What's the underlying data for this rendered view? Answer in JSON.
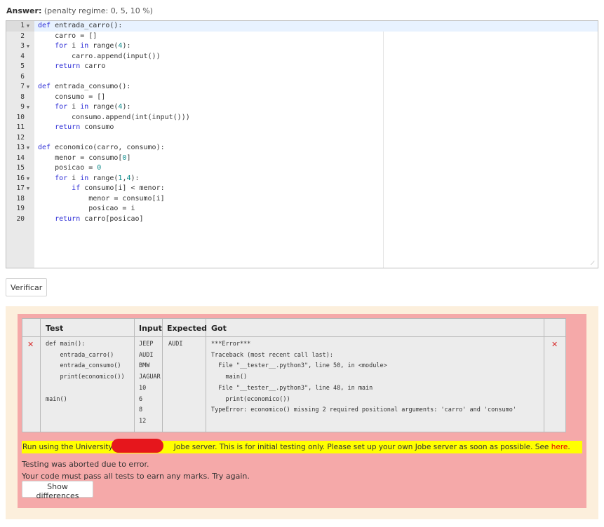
{
  "answer": {
    "label": "Answer:",
    "regime": "(penalty regime: 0, 5, 10 %)"
  },
  "editor": {
    "lines": [
      {
        "num": "1",
        "fold": true,
        "text": "def entrada_carro():"
      },
      {
        "num": "2",
        "fold": false,
        "text": "    carro = []"
      },
      {
        "num": "3",
        "fold": true,
        "text": "    for i in range(4):"
      },
      {
        "num": "4",
        "fold": false,
        "text": "        carro.append(input())"
      },
      {
        "num": "5",
        "fold": false,
        "text": "    return carro"
      },
      {
        "num": "6",
        "fold": false,
        "text": ""
      },
      {
        "num": "7",
        "fold": true,
        "text": "def entrada_consumo():"
      },
      {
        "num": "8",
        "fold": false,
        "text": "    consumo = []"
      },
      {
        "num": "9",
        "fold": true,
        "text": "    for i in range(4):"
      },
      {
        "num": "10",
        "fold": false,
        "text": "        consumo.append(int(input()))"
      },
      {
        "num": "11",
        "fold": false,
        "text": "    return consumo"
      },
      {
        "num": "12",
        "fold": false,
        "text": ""
      },
      {
        "num": "13",
        "fold": true,
        "text": "def economico(carro, consumo):"
      },
      {
        "num": "14",
        "fold": false,
        "text": "    menor = consumo[0]"
      },
      {
        "num": "15",
        "fold": false,
        "text": "    posicao = 0"
      },
      {
        "num": "16",
        "fold": true,
        "text": "    for i in range(1,4):"
      },
      {
        "num": "17",
        "fold": true,
        "text": "        if consumo[i] < menor:"
      },
      {
        "num": "18",
        "fold": false,
        "text": "            menor = consumo[i]"
      },
      {
        "num": "19",
        "fold": false,
        "text": "            posicao = i"
      },
      {
        "num": "20",
        "fold": false,
        "text": "    return carro[posicao]"
      }
    ]
  },
  "verify_button": "Verificar",
  "results": {
    "headers": {
      "test": "Test",
      "input": "Input",
      "expected": "Expected",
      "got": "Got"
    },
    "row": {
      "status_left": "✕",
      "status_right": "✕",
      "test": "def main():\n    entrada_carro()\n    entrada_consumo()\n    print(economico())\n\nmain()",
      "input": "JEEP\nAUDI\nBMW\nJAGUAR\n10\n6\n8\n12",
      "expected": "AUDI",
      "got": "***Error***\nTraceback (most recent call last):\n  File \"__tester__.python3\", line 50, in <module>\n    main()\n  File \"__tester__.python3\", line 48, in main\n    print(economico())\nTypeError: economico() missing 2 required positional arguments: 'carro' and 'consumo'"
    }
  },
  "jobe": {
    "text_before": "Run using the University o",
    "text_after": " Jobe server. This is for initial testing only. Please set up your own Jobe server as soon as possible. See ",
    "link": "here",
    "text_end": "."
  },
  "messages": {
    "aborted": "Testing was aborted due to error.",
    "must_pass": "Your code must pass all tests to earn any marks. Try again."
  },
  "diff_button": "Show differences",
  "colors": {
    "error_bg": "#f5a9a9",
    "outer_bg": "#fcefdc",
    "keyword": "#2b2bd6",
    "error_mark": "#d62b2b",
    "highlight": "#ffff00"
  }
}
